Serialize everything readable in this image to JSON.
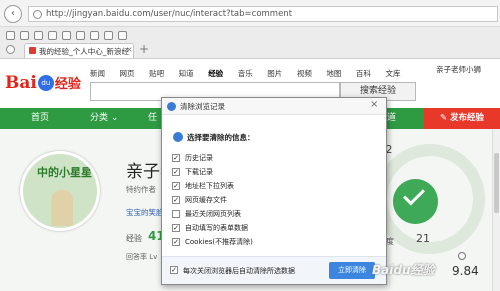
{
  "browser": {
    "back_icon": "back-arrow-icon",
    "url": "http://jingyan.baidu.com/user/nuc/interact?tab=comment",
    "tab_title": "我的经验_个人中心_新浪经",
    "tab_close": "×",
    "new_tab": "+"
  },
  "header": {
    "logo": {
      "bai": "Bai",
      "du": "du",
      "jingyan": "经验"
    },
    "nav": [
      "新闻",
      "网页",
      "贴吧",
      "知道",
      "经验",
      "音乐",
      "图片",
      "视频",
      "地图",
      "百科",
      "文库"
    ],
    "active_nav": "经验",
    "user_name": "亲子老师小狮",
    "search_value": "",
    "search_button": "搜索经验"
  },
  "green_nav": {
    "home": "首页",
    "category": "分类",
    "partial_tab": "任",
    "zhidao": "知道",
    "publish": "发布经验"
  },
  "profile": {
    "avatar_caption": "中的小星星",
    "name": "亲子老",
    "role": "特约作者",
    "link": "宝宝的笑脸",
    "exp_label": "经验",
    "exp_value": "41",
    "badge_label": "回答率 Lv",
    "stat_top": "1.32",
    "stat_mid": "21",
    "stat_huijing": "回京度",
    "stat_bottom": "9.84"
  },
  "dialog": {
    "title": "清除浏览记录",
    "close": "×",
    "section_title": "选择要清除的信息：",
    "options": [
      {
        "label": "历史记录",
        "checked": true
      },
      {
        "label": "下载记录",
        "checked": true
      },
      {
        "label": "地址栏下拉列表",
        "checked": true
      },
      {
        "label": "网页缓存文件",
        "checked": true
      },
      {
        "label": "最近关闭网页列表",
        "checked": false
      },
      {
        "label": "自动填写的表单数据",
        "checked": true
      },
      {
        "label": "Cookies(不推荐清除)",
        "checked": true
      }
    ],
    "auto_clear_label": "每次关闭浏览器后自动清除所选数据",
    "auto_clear_checked": true,
    "clear_button": "立即清除"
  },
  "watermark": "Baidu经验",
  "colors": {
    "brand_green": "#2e9b43",
    "publish_red": "#e8382a",
    "dialog_button_blue": "#3d86e0"
  }
}
